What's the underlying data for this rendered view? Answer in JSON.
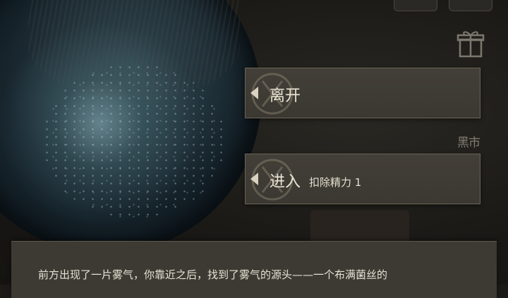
{
  "scene": {
    "description_icons": [
      "gift-icon"
    ],
    "market_label": "黑市"
  },
  "choices": [
    {
      "label": "离开",
      "cost": ""
    },
    {
      "label": "进入",
      "cost": "扣除精力 1"
    }
  ],
  "dialog": {
    "text": "前方出现了一片雾气，你靠近之后，找到了雾气的源头——一个布满菌丝的"
  },
  "colors": {
    "panel": "#3c3a33",
    "choice_bg": "#433f38",
    "text": "#ece6d6"
  }
}
